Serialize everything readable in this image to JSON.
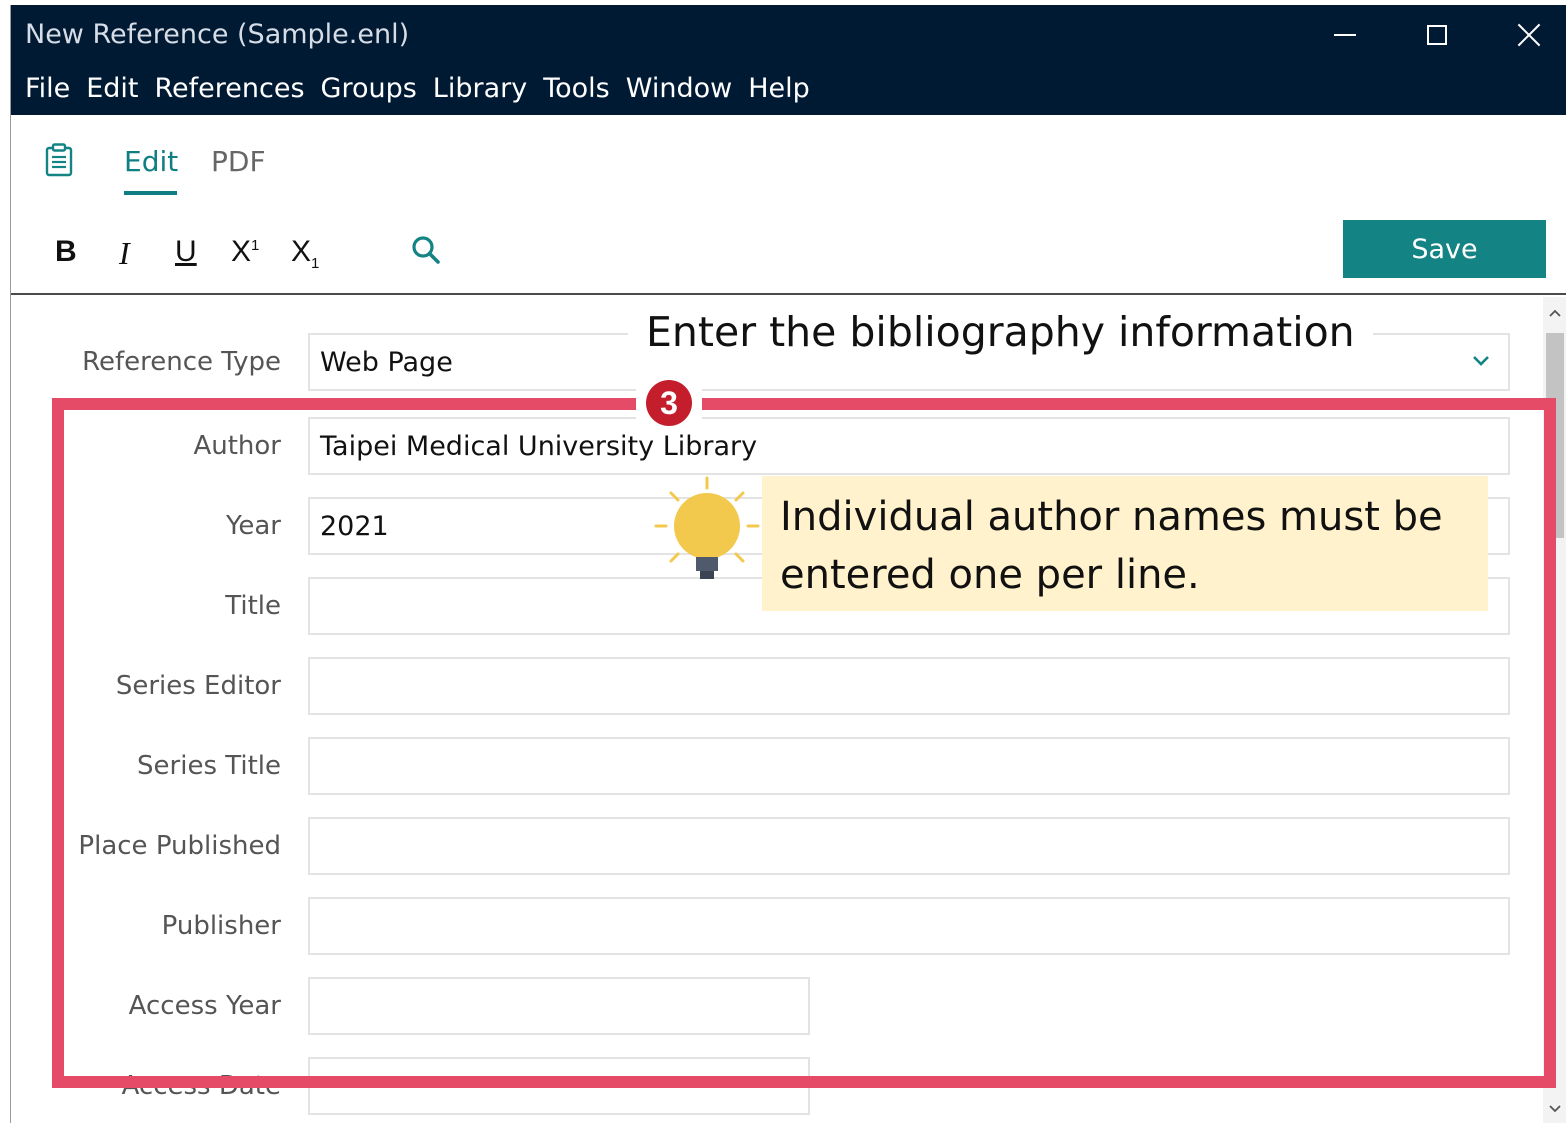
{
  "window": {
    "title": "New Reference (Sample.enl)"
  },
  "menu": [
    "File",
    "Edit",
    "References",
    "Groups",
    "Library",
    "Tools",
    "Window",
    "Help"
  ],
  "tabs": {
    "edit": "Edit",
    "pdf": "PDF"
  },
  "toolbar": {
    "bold": "B",
    "italic": "I",
    "underline": "U",
    "superscript_base": "X",
    "superscript_mark": "1",
    "subscript_base": "X",
    "subscript_mark": "1",
    "save_label": "Save"
  },
  "form": {
    "reference_type": {
      "label": "Reference Type",
      "value": "Web Page"
    },
    "fields": [
      {
        "label": "Author",
        "value": "Taipei Medical University Library"
      },
      {
        "label": "Year",
        "value": "2021"
      },
      {
        "label": "Title",
        "value": ""
      },
      {
        "label": "Series Editor",
        "value": ""
      },
      {
        "label": "Series Title",
        "value": ""
      },
      {
        "label": "Place Published",
        "value": ""
      },
      {
        "label": "Publisher",
        "value": ""
      },
      {
        "label": "Access Year",
        "value": ""
      },
      {
        "label": "Access Date",
        "value": ""
      }
    ]
  },
  "annotations": {
    "heading": "Enter the bibliography information",
    "step": "3",
    "tip": "Individual author names must be entered one per line."
  },
  "colors": {
    "titlebar": "#011a33",
    "accent": "#138383",
    "highlight": "#e54a67",
    "tip_background": "#fff2cc",
    "step_badge": "#c41e2d"
  },
  "icons": {
    "clipboard": "clipboard-icon",
    "search": "search-icon",
    "dropdown": "chevron-down-icon",
    "tip": "lightbulb-icon"
  }
}
